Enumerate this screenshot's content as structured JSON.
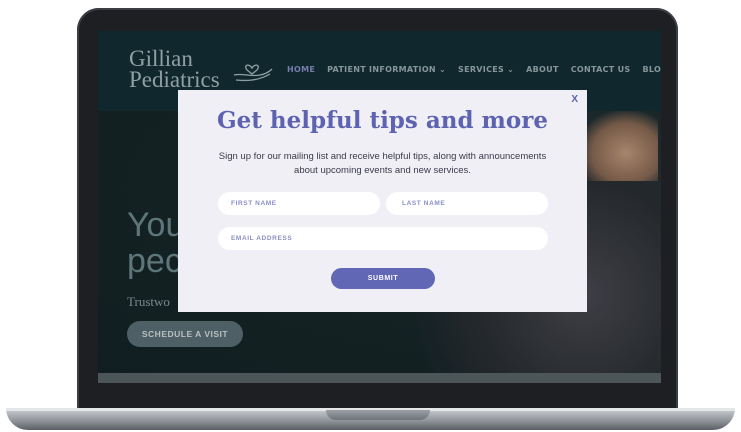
{
  "site": {
    "logo_line1": "Gillian",
    "logo_line2": "Pediatrics"
  },
  "nav": {
    "items": [
      {
        "label": "HOME"
      },
      {
        "label": "PATIENT INFORMATION ⌄"
      },
      {
        "label": "SERVICES ⌄"
      },
      {
        "label": "ABOUT"
      },
      {
        "label": "CONTACT US"
      },
      {
        "label": "BLOG"
      }
    ]
  },
  "hero": {
    "title_line1": "You",
    "title_line2": "pec",
    "subtitle": "Trustwo",
    "cta_label": "SCHEDULE A VISIT"
  },
  "popup": {
    "close_label": "X",
    "title": "Get helpful tips and more",
    "description": "Sign up for our mailing list and receive helpful tips, along with announcements about upcoming events and new services.",
    "first_name_placeholder": "FIRST NAME",
    "last_name_placeholder": "LAST NAME",
    "email_placeholder": "EMAIL ADDRESS",
    "submit_label": "SUBMIT"
  },
  "colors": {
    "accent": "#6167b5",
    "header_bg": "#133036",
    "popup_bg": "#f0eff5"
  }
}
